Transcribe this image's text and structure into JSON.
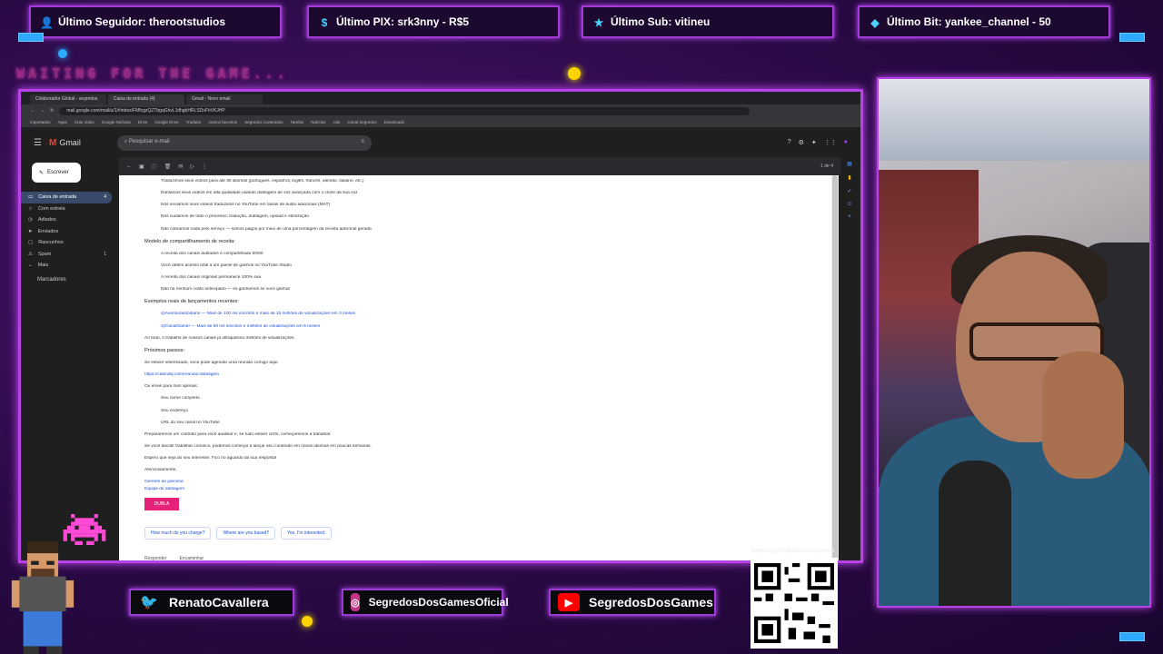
{
  "alerts": [
    {
      "label": "Último Seguidor: therootstudios",
      "icon": "follower-icon"
    },
    {
      "label": "Último PIX: srk3nny - R$5",
      "icon": "dollar-icon"
    },
    {
      "label": "Último Sub: vitineu",
      "icon": "star-icon"
    },
    {
      "label": "Último Bit: yankee_channel - 50",
      "icon": "diamond-icon"
    }
  ],
  "waiting_text": "WAITING FOR THE GAME...",
  "browser": {
    "tabs": [
      "Colaborador Global - segredos",
      "Caixa de entrada (4)",
      "Gmail - Novo email"
    ],
    "address": "mail.google.com/mail/u/1/#inbox/FMfcgzQZTbgqGhvLJdhgbHRLSDxFhVKJHP",
    "bookmarks": [
      "Importados",
      "Apps",
      "Criar vídeo",
      "Google Notícias",
      "Drive",
      "Google Drive",
      "Tradutor",
      "Outros favoritos",
      "Segredos Conteúdos",
      "Tarefas",
      "Notícias",
      "Ads",
      "Canal Segredos",
      "Downloads"
    ]
  },
  "gmail": {
    "brand": "Gmail",
    "search_placeholder": "Pesquisar e-mail",
    "compose": "Escrever",
    "sidebar": [
      {
        "label": "Caixa de entrada",
        "count": "4",
        "active": true
      },
      {
        "label": "Com estrela",
        "count": ""
      },
      {
        "label": "Adiados",
        "count": ""
      },
      {
        "label": "Enviados",
        "count": ""
      },
      {
        "label": "Rascunhos",
        "count": ""
      },
      {
        "label": "Spam",
        "count": "1"
      },
      {
        "label": "Mais",
        "count": ""
      }
    ],
    "labels_header": "Marcadores",
    "pager": "1 de 4"
  },
  "message": {
    "lines": [
      {
        "t": "Traduzimos seus vídeos para até 30 idiomas (português, espanhol, inglês, francês, alemão, italiano, etc.)",
        "li": true
      },
      {
        "t": "Dublamos seus vídeos em alta qualidade usando dublagem de voz avançada com o clone da sua voz",
        "li": true
      },
      {
        "t": "Nós enviamos seus vídeos traduzidos no YouTube em faixas de áudio adicionais (MAT)",
        "li": true
      },
      {
        "t": "Nós cuidamos de todo o processo: tradução, dublagem, upload e otimização",
        "li": true
      },
      {
        "t": "Não cobramos nada pelo serviço — somos pagos por meio de uma porcentagem da receita adicional gerada",
        "li": true
      },
      {
        "t": "Modelo de compartilhamento de receita:",
        "h": true
      },
      {
        "t": "A receita dos canais dublados é compartilhada 50/50",
        "li": true
      },
      {
        "t": "Você obtém acesso total a um painel de ganhos no YouTube Studio",
        "li": true
      },
      {
        "t": "A receita dos canais originais permanece 100% sua",
        "li": true
      },
      {
        "t": "Não há nenhum custo antecipado — só ganhamos se você ganhar",
        "li": true
      },
      {
        "t": "Exemplos reais de lançamentos recentes:",
        "h": true
      },
      {
        "t": "@Aventurasdodiario — Mais de 100 mil inscritos e mais de 15 milhões de visualizações em 3 meses",
        "li": true,
        "link": true
      },
      {
        "t": "@CanalGamer — Mais de 50 mil inscritos e milhões de visualizações em 6 meses",
        "li": true,
        "link": true
      },
      {
        "t": "Ao todo, o trabalho de nossos canais já ultrapassou milhões de visualizações.",
        "li": false
      },
      {
        "t": "Próximos passos:",
        "h": true
      },
      {
        "t": "Se estiver interessado, você pode agendar uma reunião comigo aqui:",
        "li": false
      },
      {
        "t": "https://calendly.com/reuniao-dublagem",
        "li": false,
        "link": true
      },
      {
        "t": "Ou envie para mim apenas:",
        "li": false
      },
      {
        "t": "Seu nome completo",
        "li": true
      },
      {
        "t": "Seu endereço",
        "li": true
      },
      {
        "t": "URL do seu canal no YouTube",
        "li": true
      },
      {
        "t": "Prepararemos um contrato para você analisar e, se tudo estiver certo, começaremos a trabalhar.",
        "li": false
      },
      {
        "t": "Se você decidir trabalhar conosco, podemos começar a lançar seu conteúdo em novos idiomas em poucas semanas.",
        "li": false
      },
      {
        "t": "Espero que seja do seu interesse. Fico no aguardo da sua resposta!",
        "li": false
      },
      {
        "t": "Atenciosamente,",
        "li": false
      }
    ],
    "signature": [
      "Gerente de parceria",
      "Equipe de dublagem"
    ],
    "signature_badge": "DUBLA",
    "smart_replies": [
      "How much do you charge?",
      "Where are you based?",
      "Yes, I'm interested."
    ],
    "actions": [
      "Responder",
      "Encaminhar"
    ]
  },
  "socials": [
    {
      "handle": "RenatoCavallera",
      "icon": "twitter-icon",
      "color": "#1da1f2"
    },
    {
      "handle": "SegredosDosGamesOficial",
      "icon": "instagram-icon",
      "color": "#c13584"
    },
    {
      "handle": "SegredosDosGames",
      "icon": "youtube-icon",
      "color": "#ff0000"
    }
  ],
  "qr_label": "livepix.gg/segredosdosgames",
  "colors": {
    "frame": "#b842e8",
    "accent": "#ff3ec8",
    "bg": "#2a0a45"
  }
}
